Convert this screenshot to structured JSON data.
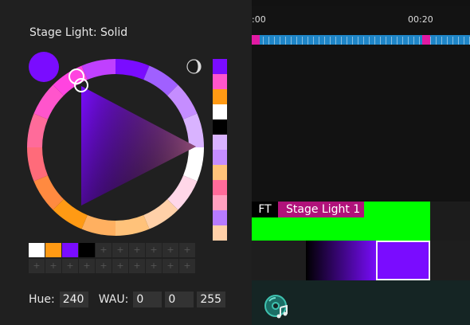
{
  "panel": {
    "title": "Stage Light: Solid",
    "current_color": "#7a0cff",
    "moon_icon": "moon-icon",
    "side_swatches": [
      "#7a0cff",
      "#ff55cc",
      "#ff9a14",
      "#ffffff",
      "#000000",
      "#d9b3ff",
      "#c58dff",
      "#ffc27a",
      "#ff6b9a",
      "#ffa0c0",
      "#b77bff",
      "#ffd0a8"
    ],
    "palette_top": [
      "#ffffff",
      "#ff9a14",
      "#7a0cff",
      "#000000"
    ],
    "palette_add_symbol": "+",
    "hue_label": "Hue:",
    "hue_value": "240",
    "wau_label": "WAU:",
    "wau_values": [
      "0",
      "0",
      "255"
    ]
  },
  "timeline": {
    "ticks": [
      ":00",
      "00:20"
    ],
    "clip_prefix": "FT",
    "clip_name": "Stage Light 1",
    "clip_color": "#00ff00",
    "track_icon": "disc-music-icon"
  }
}
